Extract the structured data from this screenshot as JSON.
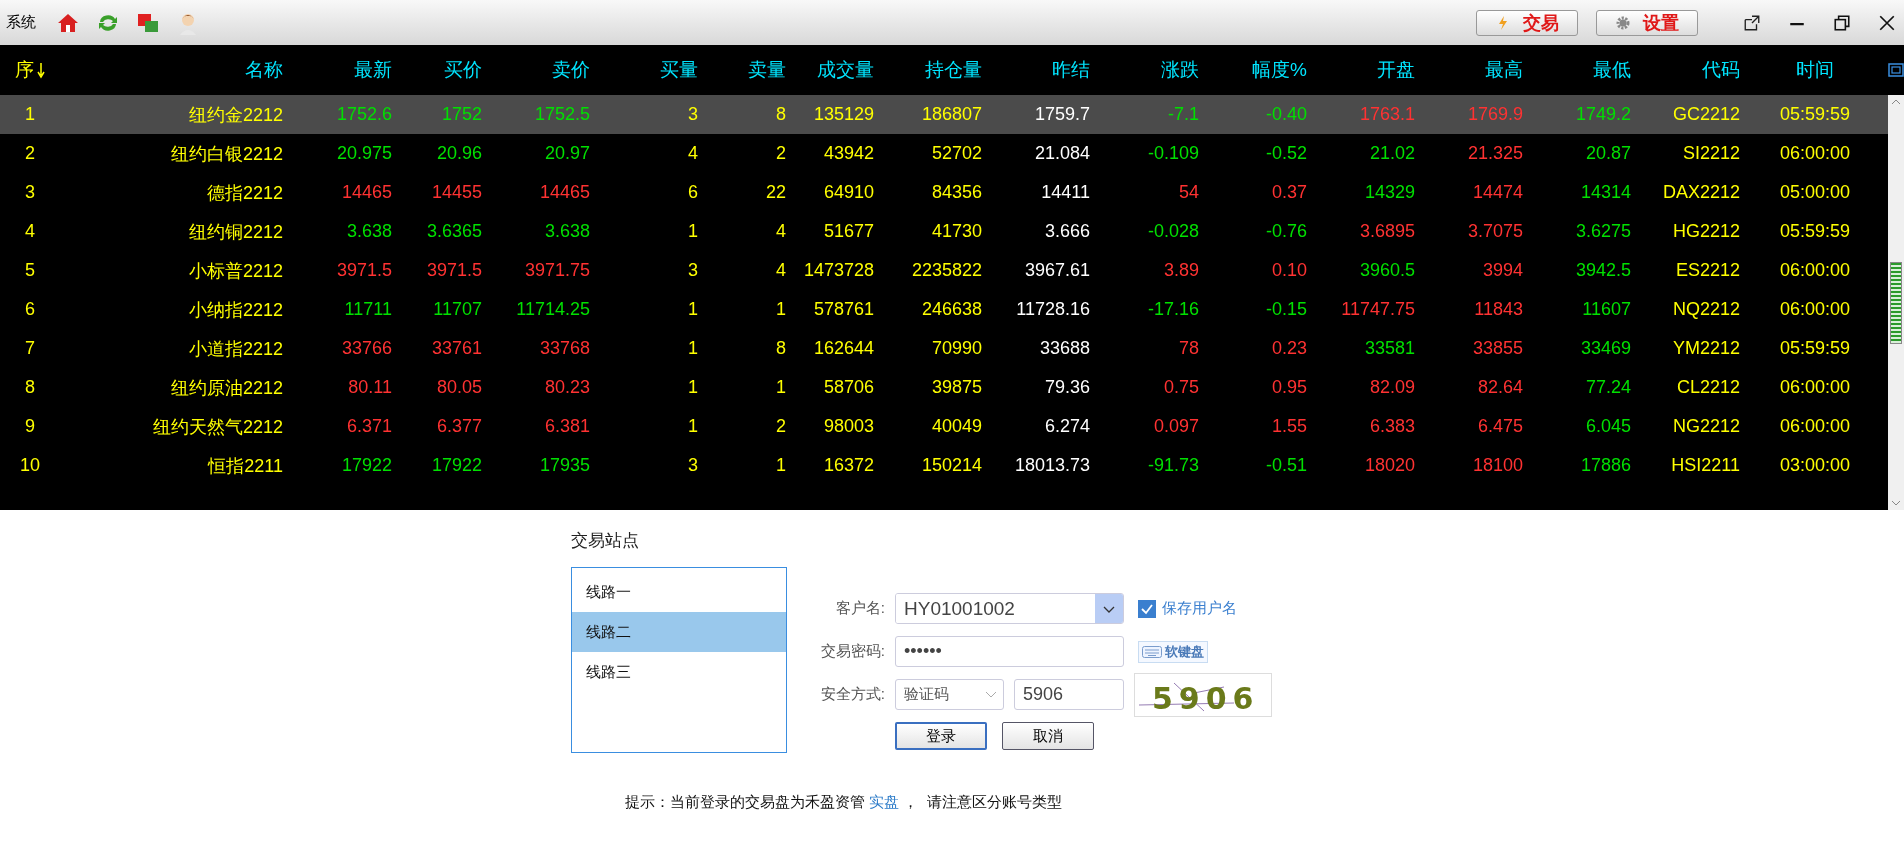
{
  "menu": {
    "label": "系统"
  },
  "toolbar_buttons": [
    {
      "label": "交易",
      "kind": "trade"
    },
    {
      "label": "设置",
      "kind": "settings"
    }
  ],
  "table": {
    "columns": [
      {
        "label": "序",
        "color": "#ffff00",
        "sorted_descending": true
      },
      {
        "label": "名称",
        "color": "#00e5ff",
        "sorted_descending": false
      },
      {
        "label": "最新",
        "color": "#00e5ff",
        "sorted_descending": false
      },
      {
        "label": "买价",
        "color": "#00e5ff",
        "sorted_descending": false
      },
      {
        "label": "卖价",
        "color": "#00e5ff",
        "sorted_descending": false
      },
      {
        "label": "买量",
        "color": "#00e5ff",
        "sorted_descending": false
      },
      {
        "label": "卖量",
        "color": "#00e5ff",
        "sorted_descending": false
      },
      {
        "label": "成交量",
        "color": "#00e5ff",
        "sorted_descending": false
      },
      {
        "label": "持仓量",
        "color": "#00e5ff",
        "sorted_descending": false
      },
      {
        "label": "昨结",
        "color": "#00e5ff",
        "sorted_descending": false
      },
      {
        "label": "涨跌",
        "color": "#00e5ff",
        "sorted_descending": false
      },
      {
        "label": "幅度%",
        "color": "#00e5ff",
        "sorted_descending": false
      },
      {
        "label": "开盘",
        "color": "#00e5ff",
        "sorted_descending": false
      },
      {
        "label": "最高",
        "color": "#00e5ff",
        "sorted_descending": false
      },
      {
        "label": "最低",
        "color": "#00e5ff",
        "sorted_descending": false
      },
      {
        "label": "代码",
        "color": "#00e5ff",
        "sorted_descending": false
      },
      {
        "label": "时间",
        "color": "#00e5ff",
        "sorted_descending": false
      }
    ],
    "rows": [
      {
        "selected": true,
        "cells": [
          {
            "text": "1",
            "color": "#ffff00"
          },
          {
            "text": "纽约金2212",
            "color": "#ffff00"
          },
          {
            "text": "1752.6",
            "color": "#00e000"
          },
          {
            "text": "1752",
            "color": "#00e000"
          },
          {
            "text": "1752.5",
            "color": "#00e000"
          },
          {
            "text": "3",
            "color": "#ffff00"
          },
          {
            "text": "8",
            "color": "#ffff00"
          },
          {
            "text": "135129",
            "color": "#ffff00"
          },
          {
            "text": "186807",
            "color": "#ffff00"
          },
          {
            "text": "1759.7",
            "color": "#ffffff"
          },
          {
            "text": "-7.1",
            "color": "#00e000"
          },
          {
            "text": "-0.40",
            "color": "#00e000"
          },
          {
            "text": "1763.1",
            "color": "#ff3232"
          },
          {
            "text": "1769.9",
            "color": "#ff3232"
          },
          {
            "text": "1749.2",
            "color": "#00e000"
          },
          {
            "text": "GC2212",
            "color": "#ffff00"
          },
          {
            "text": "05:59:59",
            "color": "#ffff00"
          }
        ]
      },
      {
        "selected": false,
        "cells": [
          {
            "text": "2",
            "color": "#ffff00"
          },
          {
            "text": "纽约白银2212",
            "color": "#ffff00"
          },
          {
            "text": "20.975",
            "color": "#00e000"
          },
          {
            "text": "20.96",
            "color": "#00e000"
          },
          {
            "text": "20.97",
            "color": "#00e000"
          },
          {
            "text": "4",
            "color": "#ffff00"
          },
          {
            "text": "2",
            "color": "#ffff00"
          },
          {
            "text": "43942",
            "color": "#ffff00"
          },
          {
            "text": "52702",
            "color": "#ffff00"
          },
          {
            "text": "21.084",
            "color": "#ffffff"
          },
          {
            "text": "-0.109",
            "color": "#00e000"
          },
          {
            "text": "-0.52",
            "color": "#00e000"
          },
          {
            "text": "21.02",
            "color": "#00e000"
          },
          {
            "text": "21.325",
            "color": "#ff3232"
          },
          {
            "text": "20.87",
            "color": "#00e000"
          },
          {
            "text": "SI2212",
            "color": "#ffff00"
          },
          {
            "text": "06:00:00",
            "color": "#ffff00"
          }
        ]
      },
      {
        "selected": false,
        "cells": [
          {
            "text": "3",
            "color": "#ffff00"
          },
          {
            "text": "德指2212",
            "color": "#ffff00"
          },
          {
            "text": "14465",
            "color": "#ff3232"
          },
          {
            "text": "14455",
            "color": "#ff3232"
          },
          {
            "text": "14465",
            "color": "#ff3232"
          },
          {
            "text": "6",
            "color": "#ffff00"
          },
          {
            "text": "22",
            "color": "#ffff00"
          },
          {
            "text": "64910",
            "color": "#ffff00"
          },
          {
            "text": "84356",
            "color": "#ffff00"
          },
          {
            "text": "14411",
            "color": "#ffffff"
          },
          {
            "text": "54",
            "color": "#ff3232"
          },
          {
            "text": "0.37",
            "color": "#ff3232"
          },
          {
            "text": "14329",
            "color": "#00e000"
          },
          {
            "text": "14474",
            "color": "#ff3232"
          },
          {
            "text": "14314",
            "color": "#00e000"
          },
          {
            "text": "DAX2212",
            "color": "#ffff00"
          },
          {
            "text": "05:00:00",
            "color": "#ffff00"
          }
        ]
      },
      {
        "selected": false,
        "cells": [
          {
            "text": "4",
            "color": "#ffff00"
          },
          {
            "text": "纽约铜2212",
            "color": "#ffff00"
          },
          {
            "text": "3.638",
            "color": "#00e000"
          },
          {
            "text": "3.6365",
            "color": "#00e000"
          },
          {
            "text": "3.638",
            "color": "#00e000"
          },
          {
            "text": "1",
            "color": "#ffff00"
          },
          {
            "text": "4",
            "color": "#ffff00"
          },
          {
            "text": "51677",
            "color": "#ffff00"
          },
          {
            "text": "41730",
            "color": "#ffff00"
          },
          {
            "text": "3.666",
            "color": "#ffffff"
          },
          {
            "text": "-0.028",
            "color": "#00e000"
          },
          {
            "text": "-0.76",
            "color": "#00e000"
          },
          {
            "text": "3.6895",
            "color": "#ff3232"
          },
          {
            "text": "3.7075",
            "color": "#ff3232"
          },
          {
            "text": "3.6275",
            "color": "#00e000"
          },
          {
            "text": "HG2212",
            "color": "#ffff00"
          },
          {
            "text": "05:59:59",
            "color": "#ffff00"
          }
        ]
      },
      {
        "selected": false,
        "cells": [
          {
            "text": "5",
            "color": "#ffff00"
          },
          {
            "text": "小标普2212",
            "color": "#ffff00"
          },
          {
            "text": "3971.5",
            "color": "#ff3232"
          },
          {
            "text": "3971.5",
            "color": "#ff3232"
          },
          {
            "text": "3971.75",
            "color": "#ff3232"
          },
          {
            "text": "3",
            "color": "#ffff00"
          },
          {
            "text": "4",
            "color": "#ffff00"
          },
          {
            "text": "1473728",
            "color": "#ffff00"
          },
          {
            "text": "2235822",
            "color": "#ffff00"
          },
          {
            "text": "3967.61",
            "color": "#ffffff"
          },
          {
            "text": "3.89",
            "color": "#ff3232"
          },
          {
            "text": "0.10",
            "color": "#ff3232"
          },
          {
            "text": "3960.5",
            "color": "#00e000"
          },
          {
            "text": "3994",
            "color": "#ff3232"
          },
          {
            "text": "3942.5",
            "color": "#00e000"
          },
          {
            "text": "ES2212",
            "color": "#ffff00"
          },
          {
            "text": "06:00:00",
            "color": "#ffff00"
          }
        ]
      },
      {
        "selected": false,
        "cells": [
          {
            "text": "6",
            "color": "#ffff00"
          },
          {
            "text": "小纳指2212",
            "color": "#ffff00"
          },
          {
            "text": "11711",
            "color": "#00e000"
          },
          {
            "text": "11707",
            "color": "#00e000"
          },
          {
            "text": "11714.25",
            "color": "#00e000"
          },
          {
            "text": "1",
            "color": "#ffff00"
          },
          {
            "text": "1",
            "color": "#ffff00"
          },
          {
            "text": "578761",
            "color": "#ffff00"
          },
          {
            "text": "246638",
            "color": "#ffff00"
          },
          {
            "text": "11728.16",
            "color": "#ffffff"
          },
          {
            "text": "-17.16",
            "color": "#00e000"
          },
          {
            "text": "-0.15",
            "color": "#00e000"
          },
          {
            "text": "11747.75",
            "color": "#ff3232"
          },
          {
            "text": "11843",
            "color": "#ff3232"
          },
          {
            "text": "11607",
            "color": "#00e000"
          },
          {
            "text": "NQ2212",
            "color": "#ffff00"
          },
          {
            "text": "06:00:00",
            "color": "#ffff00"
          }
        ]
      },
      {
        "selected": false,
        "cells": [
          {
            "text": "7",
            "color": "#ffff00"
          },
          {
            "text": "小道指2212",
            "color": "#ffff00"
          },
          {
            "text": "33766",
            "color": "#ff3232"
          },
          {
            "text": "33761",
            "color": "#ff3232"
          },
          {
            "text": "33768",
            "color": "#ff3232"
          },
          {
            "text": "1",
            "color": "#ffff00"
          },
          {
            "text": "8",
            "color": "#ffff00"
          },
          {
            "text": "162644",
            "color": "#ffff00"
          },
          {
            "text": "70990",
            "color": "#ffff00"
          },
          {
            "text": "33688",
            "color": "#ffffff"
          },
          {
            "text": "78",
            "color": "#ff3232"
          },
          {
            "text": "0.23",
            "color": "#ff3232"
          },
          {
            "text": "33581",
            "color": "#00e000"
          },
          {
            "text": "33855",
            "color": "#ff3232"
          },
          {
            "text": "33469",
            "color": "#00e000"
          },
          {
            "text": "YM2212",
            "color": "#ffff00"
          },
          {
            "text": "05:59:59",
            "color": "#ffff00"
          }
        ]
      },
      {
        "selected": false,
        "cells": [
          {
            "text": "8",
            "color": "#ffff00"
          },
          {
            "text": "纽约原油2212",
            "color": "#ffff00"
          },
          {
            "text": "80.11",
            "color": "#ff3232"
          },
          {
            "text": "80.05",
            "color": "#ff3232"
          },
          {
            "text": "80.23",
            "color": "#ff3232"
          },
          {
            "text": "1",
            "color": "#ffff00"
          },
          {
            "text": "1",
            "color": "#ffff00"
          },
          {
            "text": "58706",
            "color": "#ffff00"
          },
          {
            "text": "39875",
            "color": "#ffff00"
          },
          {
            "text": "79.36",
            "color": "#ffffff"
          },
          {
            "text": "0.75",
            "color": "#ff3232"
          },
          {
            "text": "0.95",
            "color": "#ff3232"
          },
          {
            "text": "82.09",
            "color": "#ff3232"
          },
          {
            "text": "82.64",
            "color": "#ff3232"
          },
          {
            "text": "77.24",
            "color": "#00e000"
          },
          {
            "text": "CL2212",
            "color": "#ffff00"
          },
          {
            "text": "06:00:00",
            "color": "#ffff00"
          }
        ]
      },
      {
        "selected": false,
        "cells": [
          {
            "text": "9",
            "color": "#ffff00"
          },
          {
            "text": "纽约天然气2212",
            "color": "#ffff00"
          },
          {
            "text": "6.371",
            "color": "#ff3232"
          },
          {
            "text": "6.377",
            "color": "#ff3232"
          },
          {
            "text": "6.381",
            "color": "#ff3232"
          },
          {
            "text": "1",
            "color": "#ffff00"
          },
          {
            "text": "2",
            "color": "#ffff00"
          },
          {
            "text": "98003",
            "color": "#ffff00"
          },
          {
            "text": "40049",
            "color": "#ffff00"
          },
          {
            "text": "6.274",
            "color": "#ffffff"
          },
          {
            "text": "0.097",
            "color": "#ff3232"
          },
          {
            "text": "1.55",
            "color": "#ff3232"
          },
          {
            "text": "6.383",
            "color": "#ff3232"
          },
          {
            "text": "6.475",
            "color": "#ff3232"
          },
          {
            "text": "6.045",
            "color": "#00e000"
          },
          {
            "text": "NG2212",
            "color": "#ffff00"
          },
          {
            "text": "06:00:00",
            "color": "#ffff00"
          }
        ]
      },
      {
        "selected": false,
        "cells": [
          {
            "text": "10",
            "color": "#ffff00"
          },
          {
            "text": "恒指2211",
            "color": "#ffff00"
          },
          {
            "text": "17922",
            "color": "#00e000"
          },
          {
            "text": "17922",
            "color": "#00e000"
          },
          {
            "text": "17935",
            "color": "#00e000"
          },
          {
            "text": "3",
            "color": "#ffff00"
          },
          {
            "text": "1",
            "color": "#ffff00"
          },
          {
            "text": "16372",
            "color": "#ffff00"
          },
          {
            "text": "150214",
            "color": "#ffff00"
          },
          {
            "text": "18013.73",
            "color": "#ffffff"
          },
          {
            "text": "-91.73",
            "color": "#00e000"
          },
          {
            "text": "-0.51",
            "color": "#00e000"
          },
          {
            "text": "18020",
            "color": "#ff3232"
          },
          {
            "text": "18100",
            "color": "#ff3232"
          },
          {
            "text": "17886",
            "color": "#00e000"
          },
          {
            "text": "HSI2211",
            "color": "#ffff00"
          },
          {
            "text": "03:00:00",
            "color": "#ffff00"
          }
        ]
      }
    ]
  },
  "login": {
    "title": "交易站点",
    "routes": [
      {
        "label": "线路一",
        "selected": false
      },
      {
        "label": "线路二",
        "selected": true
      },
      {
        "label": "线路三",
        "selected": false
      }
    ],
    "customer": {
      "label": "客户名:",
      "value": "HY01001002"
    },
    "save_username": {
      "label": "保存用户名",
      "checked": true
    },
    "password": {
      "label": "交易密码:",
      "value": "••••••"
    },
    "soft_keyboard": {
      "label": "软键盘"
    },
    "security": {
      "label": "安全方式:",
      "method": "验证码",
      "code": "5906"
    },
    "captcha": "5906",
    "buttons": [
      {
        "label": "登录",
        "kind": "primary"
      },
      {
        "label": "取消",
        "kind": "secondary"
      }
    ]
  },
  "hint": {
    "before": "提示：当前登录的交易盘为禾盈资管",
    "link": "实盘",
    "after": "，  请注意区分账号类型"
  }
}
